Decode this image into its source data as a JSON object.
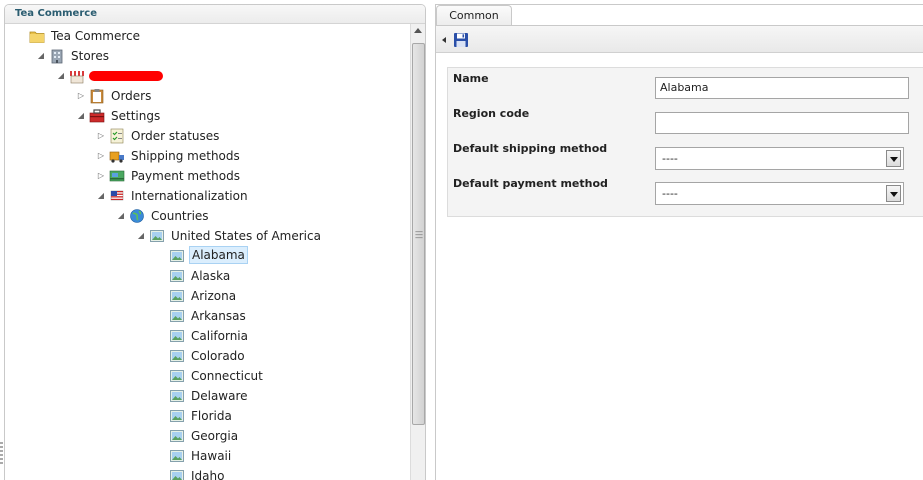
{
  "left_panel": {
    "title": "Tea Commerce"
  },
  "tree": [
    {
      "label": "Tea Commerce",
      "icon": "folder-icon",
      "arrow": "none",
      "level": 0
    },
    {
      "label": "Stores",
      "icon": "building-icon",
      "arrow": "expanded",
      "level": 1
    },
    {
      "label": "",
      "icon": "store-icon",
      "arrow": "expanded",
      "level": 2,
      "redacted": true
    },
    {
      "label": "Orders",
      "icon": "clipboard-icon",
      "arrow": "collapsed",
      "level": 3
    },
    {
      "label": "Settings",
      "icon": "toolbox-icon",
      "arrow": "expanded",
      "level": 3
    },
    {
      "label": "Order statuses",
      "icon": "checklist-icon",
      "arrow": "collapsed",
      "level": 4
    },
    {
      "label": "Shipping methods",
      "icon": "truck-icon",
      "arrow": "collapsed",
      "level": 4
    },
    {
      "label": "Payment methods",
      "icon": "payment-icon",
      "arrow": "collapsed",
      "level": 4
    },
    {
      "label": "Internationalization",
      "icon": "flag-icon",
      "arrow": "expanded",
      "level": 4
    },
    {
      "label": "Countries",
      "icon": "globe-icon",
      "arrow": "expanded",
      "level": 5
    },
    {
      "label": "United States of America",
      "icon": "image-icon",
      "arrow": "expanded",
      "level": 6
    },
    {
      "label": "Alabama",
      "icon": "image-icon",
      "arrow": "none",
      "level": 7,
      "selected": true
    },
    {
      "label": "Alaska",
      "icon": "image-icon",
      "arrow": "none",
      "level": 7
    },
    {
      "label": "Arizona",
      "icon": "image-icon",
      "arrow": "none",
      "level": 7
    },
    {
      "label": "Arkansas",
      "icon": "image-icon",
      "arrow": "none",
      "level": 7
    },
    {
      "label": "California",
      "icon": "image-icon",
      "arrow": "none",
      "level": 7
    },
    {
      "label": "Colorado",
      "icon": "image-icon",
      "arrow": "none",
      "level": 7
    },
    {
      "label": "Connecticut",
      "icon": "image-icon",
      "arrow": "none",
      "level": 7
    },
    {
      "label": "Delaware",
      "icon": "image-icon",
      "arrow": "none",
      "level": 7
    },
    {
      "label": "Florida",
      "icon": "image-icon",
      "arrow": "none",
      "level": 7
    },
    {
      "label": "Georgia",
      "icon": "image-icon",
      "arrow": "none",
      "level": 7
    },
    {
      "label": "Hawaii",
      "icon": "image-icon",
      "arrow": "none",
      "level": 7
    },
    {
      "label": "Idaho",
      "icon": "image-icon",
      "arrow": "none",
      "level": 7
    }
  ],
  "right_panel": {
    "tab_label": "Common",
    "save_icon": "save-icon",
    "form": {
      "name_label": "Name",
      "name_value": "Alabama",
      "region_label": "Region code",
      "region_value": "",
      "shipping_label": "Default shipping method",
      "shipping_value": "----",
      "payment_label": "Default payment method",
      "payment_value": "----"
    }
  },
  "colors": {
    "header_text": "#2a5c70",
    "selection_bg": "#dbeefd",
    "redaction": "#ff0000"
  }
}
